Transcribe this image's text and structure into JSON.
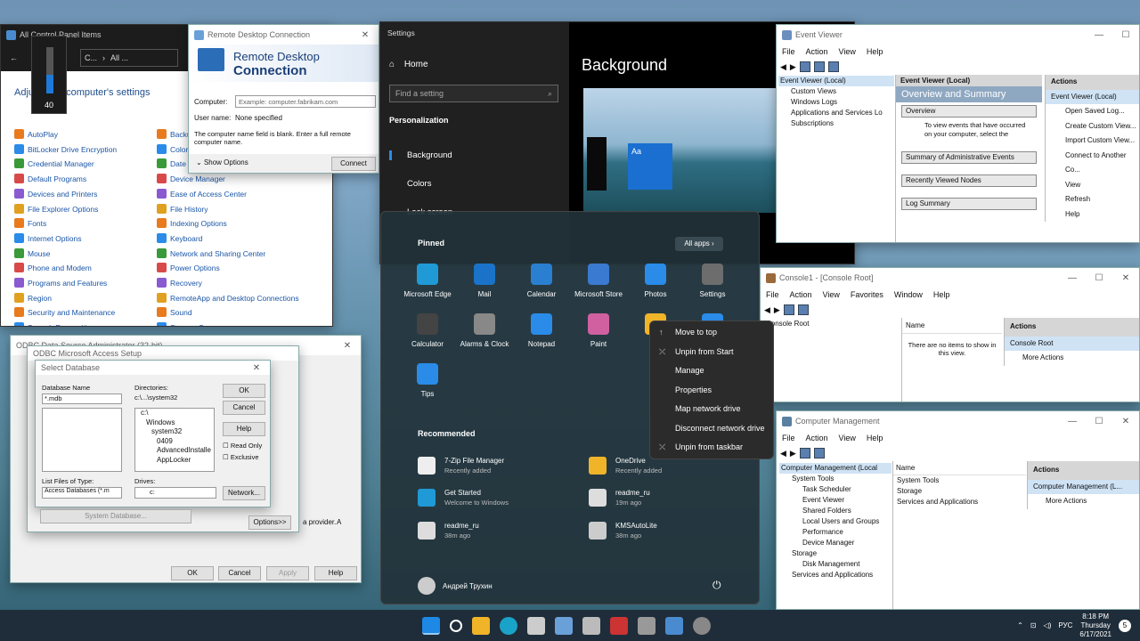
{
  "control_panel": {
    "title": "All Control Panel Items",
    "path": [
      "C...",
      "All ..."
    ],
    "heading": "Adjust your computer's settings",
    "volume": "40",
    "col1": [
      "AutoPlay",
      "BitLocker Drive Encryption",
      "Credential Manager",
      "Default Programs",
      "Devices and Printers",
      "File Explorer Options",
      "Fonts",
      "Internet Options",
      "Mouse",
      "Phone and Modem",
      "Programs and Features",
      "Region",
      "Security and Maintenance",
      "Speech Recognition"
    ],
    "col2": [
      "Backup",
      "Color",
      "Date a",
      "Device Manager",
      "Ease of Access Center",
      "File History",
      "Indexing Options",
      "Keyboard",
      "Network and Sharing Center",
      "Power Options",
      "Recovery",
      "RemoteApp and Desktop Connections",
      "Sound",
      "Storage Spaces"
    ]
  },
  "rdc": {
    "title": "Remote Desktop Connection",
    "h1": "Remote Desktop",
    "h2": "Connection",
    "computer_label": "Computer:",
    "computer_placeholder": "Example: computer.fabrikam.com",
    "user_label": "User name:",
    "user_value": "None specified",
    "note": "The computer name field is blank. Enter a full remote computer name.",
    "show_options": "Show Options",
    "connect": "Connect"
  },
  "settings": {
    "title": "Settings",
    "home": "Home",
    "search_placeholder": "Find a setting",
    "section": "Personalization",
    "items": [
      "Background",
      "Colors",
      "Lock screen"
    ],
    "page_title": "Background",
    "tile_label": "Aa"
  },
  "start": {
    "pinned": "Pinned",
    "all_apps": "All apps",
    "apps": [
      "Microsoft Edge",
      "Mail",
      "Calendar",
      "Microsoft Store",
      "Photos",
      "Settings",
      "Calculator",
      "Alarms & Clock",
      "Notepad",
      "Paint",
      "File",
      "",
      "Tips"
    ],
    "recommended": "Recommended",
    "rec": [
      {
        "name": "7-Zip File Manager",
        "sub": "Recently added"
      },
      {
        "name": "OneDrive",
        "sub": "Recently added"
      },
      {
        "name": "Get Started",
        "sub": "Welcome to Windows"
      },
      {
        "name": "readme_ru",
        "sub": "19m ago"
      },
      {
        "name": "readme_ru",
        "sub": "38m ago"
      },
      {
        "name": "KMSAutoLite",
        "sub": "38m ago"
      }
    ],
    "user": "Андрей Трухин"
  },
  "context_menu": [
    "Move to top",
    "Unpin from Start",
    "Manage",
    "Properties",
    "Map network drive",
    "Disconnect network drive",
    "Unpin from taskbar"
  ],
  "event_viewer": {
    "title": "Event Viewer",
    "menu": [
      "File",
      "Action",
      "View",
      "Help"
    ],
    "tree": [
      "Event Viewer (Local)",
      "Custom Views",
      "Windows Logs",
      "Applications and Services Lo",
      "Subscriptions"
    ],
    "center_head": "Event Viewer (Local)",
    "overview_title": "Overview and Summary",
    "sections": [
      "Overview",
      "Summary of Administrative Events",
      "Recently Viewed Nodes",
      "Log Summary"
    ],
    "overview_text": "To view events that have occurred on your computer, select the",
    "actions_head": "Actions",
    "actions": [
      "Event Viewer (Local)",
      "Open Saved Log...",
      "Create Custom View...",
      "Import Custom View...",
      "Connect to Another Co...",
      "View",
      "Refresh",
      "Help"
    ]
  },
  "console": {
    "title": "Console1 - [Console Root]",
    "menu": [
      "File",
      "Action",
      "View",
      "Favorites",
      "Window",
      "Help"
    ],
    "root": "Console Root",
    "name_col": "Name",
    "empty": "There are no items to show in this view.",
    "actions_head": "Actions",
    "actions": [
      "Console Root",
      "More Actions"
    ]
  },
  "comp_mgmt": {
    "title": "Computer Management",
    "menu": [
      "File",
      "Action",
      "View",
      "Help"
    ],
    "tree": [
      "Computer Management (Local",
      "System Tools",
      "Task Scheduler",
      "Event Viewer",
      "Shared Folders",
      "Local Users and Groups",
      "Performance",
      "Device Manager",
      "Storage",
      "Disk Management",
      "Services and Applications"
    ],
    "name_col": "Name",
    "items": [
      "System Tools",
      "Storage",
      "Services and Applications"
    ],
    "actions_head": "Actions",
    "actions": [
      "Computer Management (L...",
      "More Actions"
    ]
  },
  "odbc": {
    "title": "ODBC Data Source Administrator (32-bit)",
    "inner_title": "ODBC Microsoft Access Setup",
    "ok": "OK",
    "cancel": "Cancel",
    "apply": "Apply",
    "help": "Help",
    "provider_text": "a provider.",
    "a_label": "A"
  },
  "select_db": {
    "title": "Select Database",
    "db_name_label": "Database Name",
    "db_name_value": "*.mdb",
    "dirs_label": "Directories:",
    "dirs_value": "c:\\...\\system32",
    "dirs": [
      "c:\\",
      "Windows",
      "system32",
      "0409",
      "AdvancedInstalle",
      "AppLocker"
    ],
    "ok": "OK",
    "cancel": "Cancel",
    "help": "Help",
    "readonly": "Read Only",
    "exclusive": "Exclusive",
    "types_label": "List Files of Type:",
    "types_value": "Access Databases (*.m",
    "drives_label": "Drives:",
    "drives_value": "c:",
    "network": "Network...",
    "system_db": "System Database...",
    "options": "Options>>"
  },
  "taskbar": {
    "lang": "РУС",
    "time": "8:18 PM",
    "day": "Thursday",
    "date": "6/17/2021",
    "notif": "5"
  }
}
